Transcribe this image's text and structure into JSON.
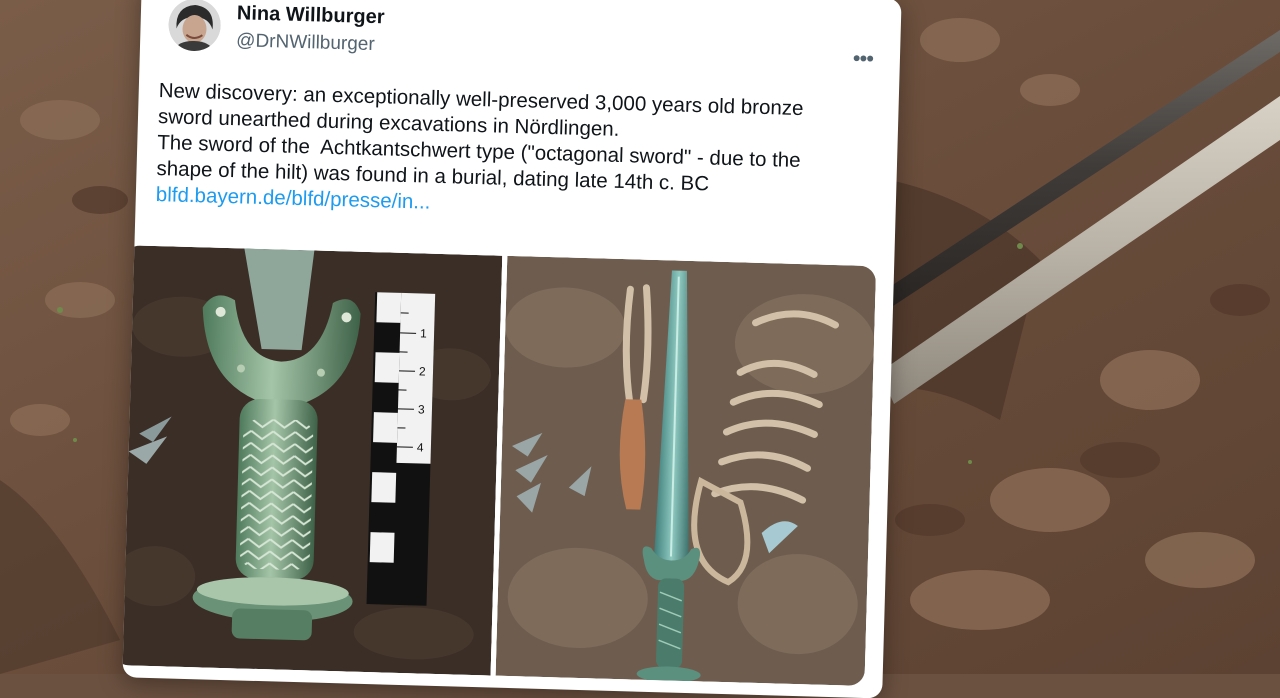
{
  "tweet": {
    "author_name": "Nina Willburger",
    "author_handle": "@DrNWillburger",
    "more_icon": "more-dots-icon",
    "text_lines": [
      "New discovery: an exceptionally well-preserved 3,000 years old bronze",
      "sword unearthed during excavations in Nördlingen.",
      "The sword of the  Achtkantschwert type (\"octagonal sword\" - due to the",
      "shape of the hilt) was found in a burial, dating late 14th c. BC"
    ],
    "link_text": "blfd.bayern.de/blfd/presse/in...",
    "link_color": "#1d9bf0"
  },
  "photo_left": {
    "scale_labels": [
      "1",
      "2",
      "3",
      "4"
    ]
  },
  "colors": {
    "soil": "#6b5140",
    "bronze": "#6f9a78",
    "card": "#ffffff"
  }
}
